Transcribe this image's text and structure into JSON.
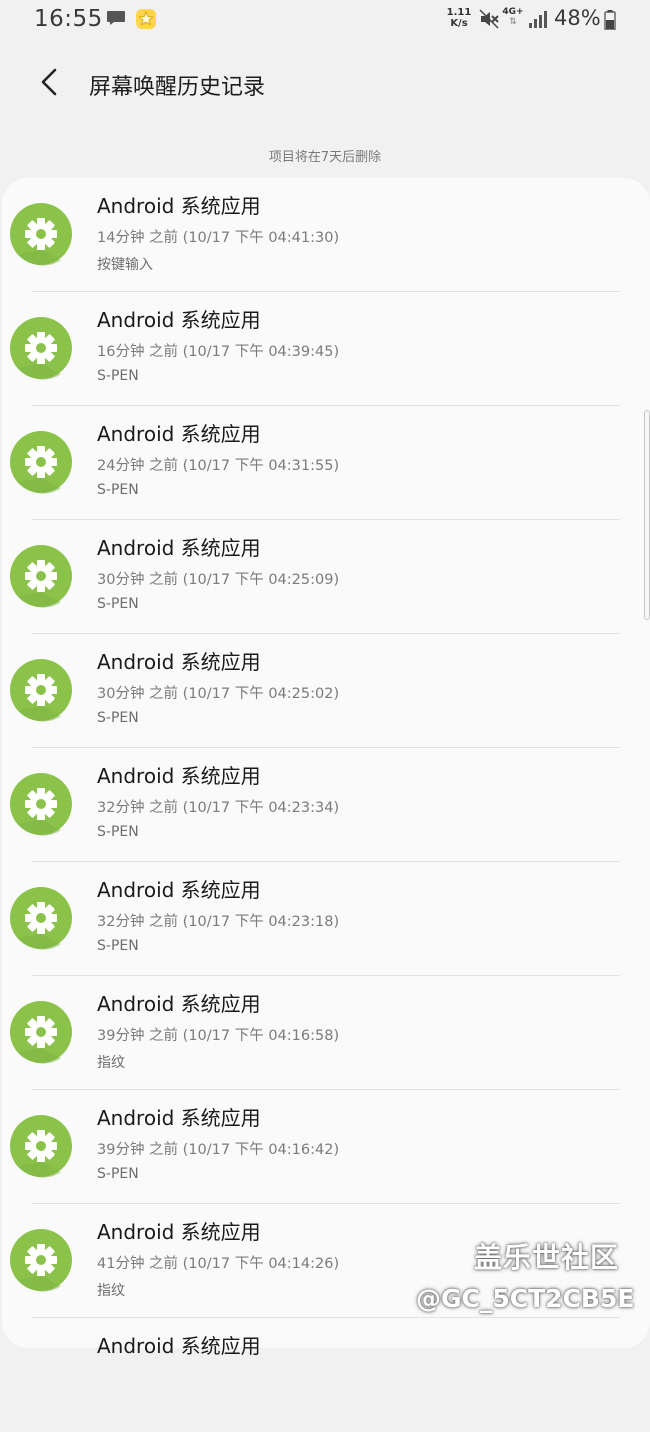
{
  "status_bar": {
    "time": "16:55",
    "speed_value": "1.11",
    "speed_unit": "K/s",
    "network": "4G+",
    "battery": "48%"
  },
  "header": {
    "title": "屏幕唤醒历史记录"
  },
  "notice": "项目将在7天后删除",
  "items": [
    {
      "title": "Android 系统应用",
      "time": "14分钟 之前 (10/17 下午 04:41:30)",
      "source": "按键输入"
    },
    {
      "title": "Android 系统应用",
      "time": "16分钟 之前 (10/17 下午 04:39:45)",
      "source": "S-PEN"
    },
    {
      "title": "Android 系统应用",
      "time": "24分钟 之前 (10/17 下午 04:31:55)",
      "source": "S-PEN"
    },
    {
      "title": "Android 系统应用",
      "time": "30分钟 之前 (10/17 下午 04:25:09)",
      "source": "S-PEN"
    },
    {
      "title": "Android 系统应用",
      "time": "30分钟 之前 (10/17 下午 04:25:02)",
      "source": "S-PEN"
    },
    {
      "title": "Android 系统应用",
      "time": "32分钟 之前 (10/17 下午 04:23:34)",
      "source": "S-PEN"
    },
    {
      "title": "Android 系统应用",
      "time": "32分钟 之前 (10/17 下午 04:23:18)",
      "source": "S-PEN"
    },
    {
      "title": "Android 系统应用",
      "time": "39分钟 之前 (10/17 下午 04:16:58)",
      "source": "指纹"
    },
    {
      "title": "Android 系统应用",
      "time": "39分钟 之前 (10/17 下午 04:16:42)",
      "source": "S-PEN"
    },
    {
      "title": "Android 系统应用",
      "time": "41分钟 之前 (10/17 下午 04:14:26)",
      "source": "指纹"
    },
    {
      "title": "Android 系统应用",
      "time": "",
      "source": ""
    }
  ],
  "watermark": {
    "site": "盖乐世社区",
    "user": "@GC_5CT2CB5E"
  },
  "colors": {
    "icon_green": "#8bc34a",
    "background": "#f1f1f1",
    "card": "#fafafa"
  },
  "icons": {
    "app_icon": "gear-icon",
    "back": "back-arrow-icon"
  }
}
